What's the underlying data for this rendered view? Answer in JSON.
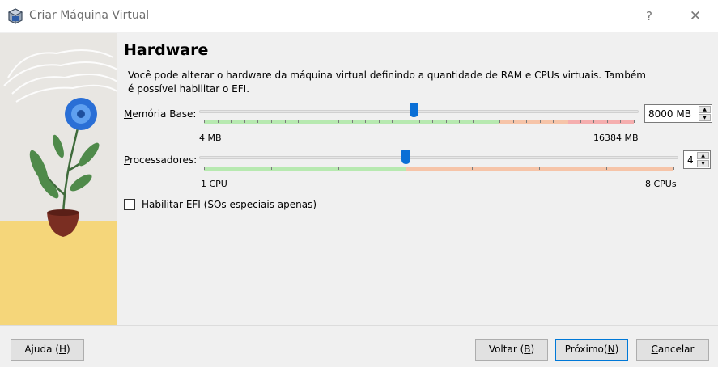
{
  "window": {
    "title": "Criar Máquina Virtual",
    "help_label": "?",
    "close_label": "✕"
  },
  "page": {
    "heading": "Hardware",
    "description": "Você pode alterar o hardware da máquina virtual definindo a quantidade de RAM e CPUs virtuais. Também é possível habilitar o EFI."
  },
  "memory": {
    "label_prefix": "M",
    "label_rest": "emória Base:",
    "min_label": "4 MB",
    "max_label": "16384 MB",
    "value": "8000 MB",
    "value_mb": 8000,
    "min_mb": 4,
    "max_mb": 16384
  },
  "processors": {
    "label_prefix": "P",
    "label_rest": "rocessadores:",
    "min_label": "1 CPU",
    "max_label": "8 CPUs",
    "value": "4",
    "value_num": 4
  },
  "efi": {
    "label_before": "Habilitar ",
    "label_underlined": "E",
    "label_after": "FI (SOs especiais apenas)",
    "checked": false
  },
  "footer": {
    "help": {
      "before": "Ajuda (",
      "key": "H",
      "after": ")"
    },
    "back": {
      "before": "Voltar (",
      "key": "B",
      "after": ")"
    },
    "next": {
      "before": "Próximo(",
      "key": "N",
      "after": ")"
    },
    "cancel": {
      "before": "",
      "key": "C",
      "after": "ancelar"
    }
  },
  "colors": {
    "slider_thumb": "#0a6fd6",
    "zone_green": "#b7e9b0",
    "zone_orange": "#f6c4a8",
    "zone_red": "#f5aeae",
    "art_sand": "#f5d67a"
  }
}
